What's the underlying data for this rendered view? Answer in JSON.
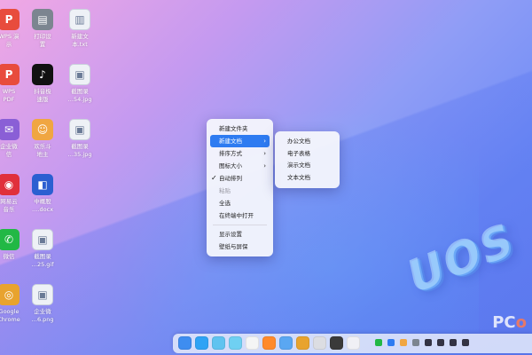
{
  "colors": {
    "menu_highlight": "#2e7bf1",
    "wallpaper_top": "#f1a8e4",
    "wallpaper_bottom": "#6a86f2"
  },
  "desktop_icons": [
    {
      "name": "wps-presentation-icon",
      "glyph": "P",
      "color": "#e84c3d",
      "label1": "WPS 演",
      "label2": "示"
    },
    {
      "name": "print-settings-icon",
      "glyph": "▤",
      "color": "#7c8590",
      "label1": "打印设",
      "label2": "置"
    },
    {
      "name": "new-text-file-icon",
      "glyph": "▥",
      "color": "#eef1f6",
      "label1": "新建文",
      "label2": "本.txt"
    },
    {
      "name": "wps-pdf-icon",
      "glyph": "P",
      "color": "#e84c3d",
      "label1": "WPS",
      "label2": "PDF"
    },
    {
      "name": "tiktok-icon",
      "glyph": "♪",
      "color": "#111111",
      "label1": "抖音极",
      "label2": "速版"
    },
    {
      "name": "screenshot-image-1-icon",
      "glyph": "▣",
      "color": "#eef1f6",
      "label1": "截图录",
      "label2": "…54.jpg"
    },
    {
      "name": "enterprise-wechat-icon",
      "glyph": "✉",
      "color": "#8a5fd6",
      "label1": "企业微",
      "label2": "信"
    },
    {
      "name": "game-character-icon",
      "glyph": "☺",
      "color": "#f0a642",
      "label1": "欢乐斗",
      "label2": "地主"
    },
    {
      "name": "screenshot-image-2-icon",
      "glyph": "▣",
      "color": "#eef1f6",
      "label1": "截图录",
      "label2": "…35.jpg"
    },
    {
      "name": "netease-music-icon",
      "glyph": "◉",
      "color": "#e0303b",
      "label1": "网易云",
      "label2": "音乐"
    },
    {
      "name": "office-doc-icon",
      "glyph": "◧",
      "color": "#2b5fd1",
      "label1": "中概股",
      "label2": "….docx"
    },
    {
      "name": "wechat-icon",
      "glyph": "✆",
      "color": "#22b845",
      "label1": "微信",
      "label2": ""
    },
    {
      "name": "screenshot-image-3-icon",
      "glyph": "▣",
      "color": "#eef1f6",
      "label1": "截图录",
      "label2": "…25.gif"
    },
    {
      "name": "chrome-icon",
      "glyph": "◎",
      "color": "#e8a32e",
      "label1": "Google",
      "label2": "Chrome"
    },
    {
      "name": "enterprise-wechat-image-icon",
      "glyph": "▣",
      "color": "#eef1f6",
      "label1": "企业微",
      "label2": "…6.png"
    }
  ],
  "context_menu": {
    "items": [
      {
        "label": "新建文件夹",
        "state": "normal",
        "submenu": false,
        "checked": false
      },
      {
        "label": "新建文档",
        "state": "active",
        "submenu": true,
        "checked": false
      },
      {
        "label": "排序方式",
        "state": "normal",
        "submenu": true,
        "checked": false
      },
      {
        "label": "图标大小",
        "state": "normal",
        "submenu": true,
        "checked": false
      },
      {
        "label": "自动排列",
        "state": "normal",
        "submenu": false,
        "checked": true
      },
      {
        "label": "粘贴",
        "state": "disabled",
        "submenu": false,
        "checked": false
      },
      {
        "label": "全选",
        "state": "normal",
        "submenu": false,
        "checked": false
      },
      {
        "label": "在终端中打开",
        "state": "normal",
        "submenu": false,
        "checked": false
      },
      {
        "separator": true
      },
      {
        "label": "显示设置",
        "state": "normal",
        "submenu": false,
        "checked": false
      },
      {
        "label": "壁纸与屏保",
        "state": "normal",
        "submenu": false,
        "checked": false
      }
    ]
  },
  "submenu": {
    "items": [
      "办公文档",
      "电子表格",
      "演示文档",
      "文本文档"
    ]
  },
  "wallpaper_text": "UOS",
  "watermark": {
    "prefix": "PC",
    "suffix": "o"
  },
  "dock_apps": [
    {
      "name": "file-manager-icon",
      "color": "#3e8df0"
    },
    {
      "name": "browser-icon",
      "color": "#2fa3f5"
    },
    {
      "name": "photo-viewer-icon",
      "color": "#5fc3f0"
    },
    {
      "name": "music-player-icon",
      "color": "#6fd0f2"
    },
    {
      "name": "calendar-icon",
      "color": "#f5f5f5"
    },
    {
      "name": "app-store-icon",
      "color": "#ff8a2b"
    },
    {
      "name": "control-center-icon",
      "color": "#5aa7f2"
    },
    {
      "name": "chrome-dock-icon",
      "color": "#e8a32e"
    },
    {
      "name": "printer-dock-icon",
      "color": "#dcdde2"
    },
    {
      "name": "dark-app-icon",
      "color": "#3a3a3a"
    },
    {
      "name": "screenshot-dock-icon",
      "color": "#f0f0f5"
    }
  ],
  "tray_icons": [
    {
      "name": "tray-green-icon",
      "color": "#22b845"
    },
    {
      "name": "tray-blue-icon",
      "color": "#2e7bf1"
    },
    {
      "name": "tray-orange-icon",
      "color": "#f0a642"
    },
    {
      "name": "tray-gray-icon",
      "color": "#7c8590"
    },
    {
      "name": "tray-wifi-icon",
      "color": "#333344"
    },
    {
      "name": "tray-battery-icon",
      "color": "#333344"
    },
    {
      "name": "tray-volume-icon",
      "color": "#333344"
    },
    {
      "name": "tray-power-icon",
      "color": "#333344"
    }
  ]
}
